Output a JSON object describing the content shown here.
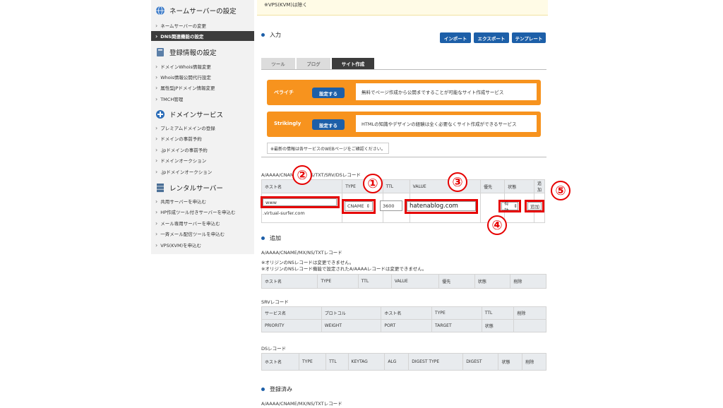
{
  "sidebar": {
    "sections": [
      {
        "title": "ネームサーバーの設定",
        "icon": "globe-icon",
        "items": [
          "ネームサーバーの変更",
          "DNS関連機能の設定"
        ]
      },
      {
        "title": "登録情報の設定",
        "icon": "book-icon",
        "items": [
          "ドメインWhois情報変更",
          "Whois情報公開代行設定",
          "属性型JPドメイン情報変更",
          "TMCH管理"
        ]
      },
      {
        "title": "ドメインサービス",
        "icon": "plus-icon",
        "items": [
          "プレミアムドメインの登録",
          "ドメインの事前予約",
          ".jpドメインの事前予約",
          "ドメインオークション",
          ".jpドメインオークション"
        ]
      },
      {
        "title": "レンタルサーバー",
        "icon": "server-icon",
        "items": [
          "共用サーバーを申込む",
          "HP作成ツール付きサーバーを申込む",
          "メール専用サーバーを申込む",
          "一斉メール配信ツールを申込む",
          "VPS(KVM)を申込む"
        ]
      }
    ],
    "active_item": "DNS関連機能の設定"
  },
  "notice": "※VPS(KVM)は除く",
  "input_section": {
    "title": "入力",
    "buttons": [
      "インポート",
      "エクスポート",
      "テンプレート"
    ],
    "tabs": [
      "ツール",
      "ブログ",
      "サイト作成"
    ],
    "active_tab": "サイト作成"
  },
  "services": [
    {
      "name": "ペライチ",
      "button": "設定する",
      "desc": "無料でページ作成から公開まですることが可能なサイト作成サービス"
    },
    {
      "name": "Strikingly",
      "button": "設定する",
      "desc": "HTMLの知識やデザインの経験は全く必要なくサイト作成ができるサービス"
    }
  ],
  "service_note": "※最新の情報は各サービスのWEBページをご確認ください。",
  "record_form": {
    "caption": "A/AAAA/CNAME/MX/NS/TXT/SRV/DSレコード",
    "headers": [
      "ホスト名",
      "TYPE",
      "TTL",
      "VALUE",
      "優先",
      "状態",
      "追加"
    ],
    "host_value": "www",
    "domain_suffix": ".virtual-surfer.com",
    "type_value": "CNAME",
    "ttl_value": "3600",
    "value_value": "hatenablog.com",
    "status_value": "有効",
    "add_button": "追加"
  },
  "annotations": [
    "②",
    "①",
    "③",
    "⑤",
    "④"
  ],
  "add_section": {
    "title": "追加",
    "caption": "A/AAAA/CNAME/MX/NS/TXTレコード",
    "notes": [
      "※オリジンのNSレコードは変更できません。",
      "※オリジンのNSレコード機能で設定されたA/AAAAレコードは変更できません。"
    ],
    "table1_headers": [
      "ホスト名",
      "TYPE",
      "TTL",
      "VALUE",
      "優先",
      "状態",
      "削除"
    ],
    "srv_caption": "SRVレコード",
    "srv_row1": [
      "サービス名",
      "プロトコル",
      "ホスト名",
      "TYPE",
      "TTL",
      "削除"
    ],
    "srv_row2": [
      "PRIORITY",
      "WEIGHT",
      "PORT",
      "TARGET",
      "状態"
    ],
    "ds_caption": "DSレコード",
    "ds_headers": [
      "ホスト名",
      "TYPE",
      "TTL",
      "KEYTAG",
      "ALG",
      "DIGEST TYPE",
      "DIGEST",
      "状態",
      "削除"
    ]
  },
  "registered_section": {
    "title": "登録済み",
    "caption": "A/AAAA/CNAME/MX/NS/TXTレコード"
  },
  "colors": {
    "accent_blue": "#1d5fa8",
    "orange": "#f7931e",
    "annotation_red": "#e60000"
  }
}
